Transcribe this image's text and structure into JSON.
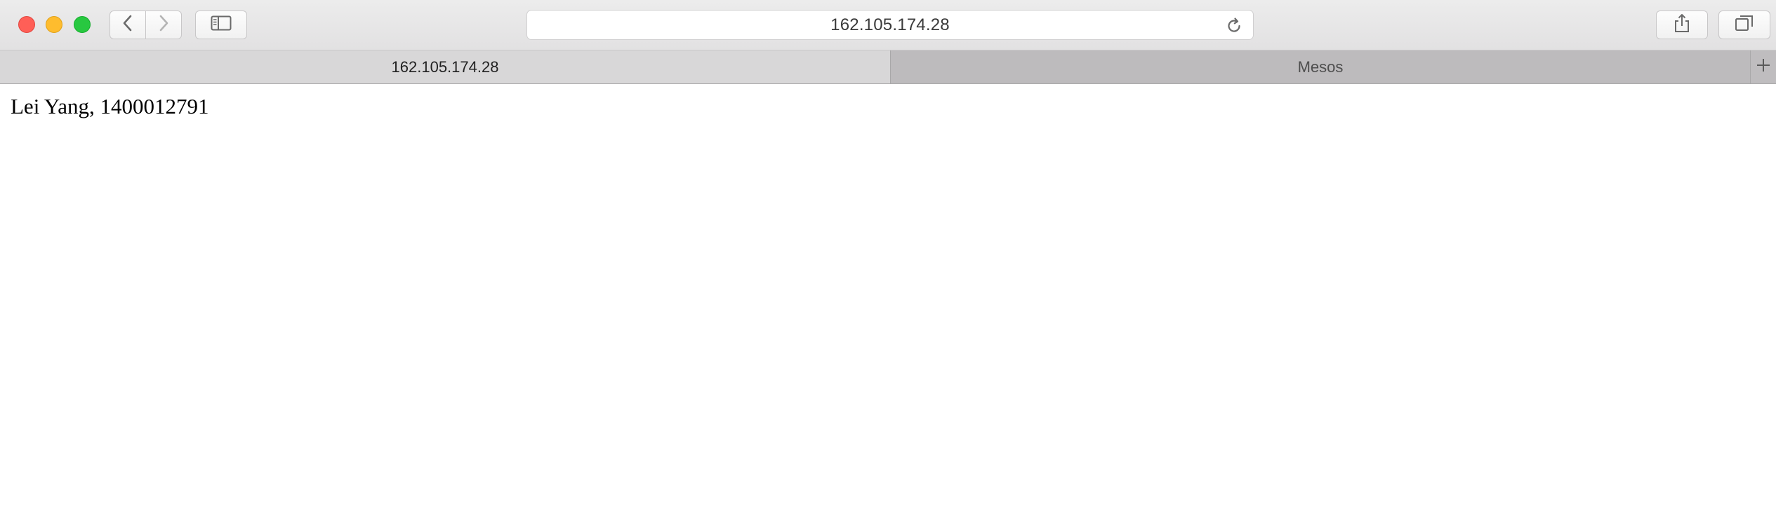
{
  "browser": {
    "address_bar": {
      "url": "162.105.174.28"
    },
    "tabs": [
      {
        "label": "162.105.174.28",
        "active": true
      },
      {
        "label": "Mesos",
        "active": false
      }
    ],
    "icons": {
      "back": "chevron-left-icon",
      "forward": "chevron-right-icon",
      "sidebar": "sidebar-icon",
      "reload": "reload-icon",
      "share": "share-icon",
      "tab_overview": "tab-overview-icon",
      "new_tab": "plus-icon"
    },
    "colors": {
      "close": "#ff5f57",
      "minimize": "#febc2e",
      "maximize": "#28c840"
    }
  },
  "page": {
    "body_text": "Lei Yang, 1400012791"
  }
}
